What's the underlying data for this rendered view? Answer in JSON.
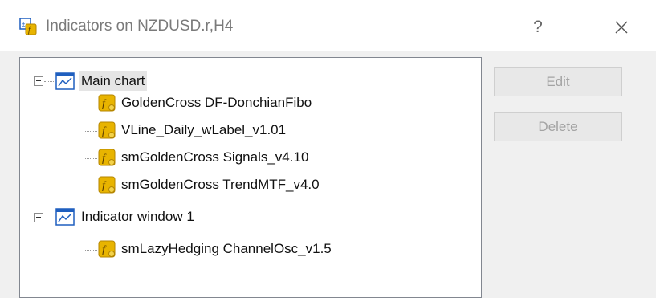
{
  "window": {
    "title": "Indicators on NZDUSD.r,H4",
    "help_label": "?"
  },
  "icons": {
    "app": "indicators-app-icon",
    "group": "chart-window-icon",
    "indicator": "custom-indicator-icon",
    "close": "close-icon"
  },
  "tree": {
    "groups": [
      {
        "label": "Main chart",
        "selected": true,
        "indicators": [
          "GoldenCross DF-DonchianFibo",
          "VLine_Daily_wLabel_v1.01",
          "smGoldenCross Signals_v4.10",
          "smGoldenCross TrendMTF_v4.0"
        ]
      },
      {
        "label": "Indicator window 1",
        "selected": false,
        "indicators": [
          "smLazyHedging ChannelOsc_v1.5"
        ]
      }
    ]
  },
  "buttons": {
    "edit_label": "Edit",
    "delete_label": "Delete"
  },
  "colors": {
    "indicator_icon": "#e8b400",
    "chart_icon": "#1f5fbf",
    "disabled_text": "#a3a3a3"
  }
}
